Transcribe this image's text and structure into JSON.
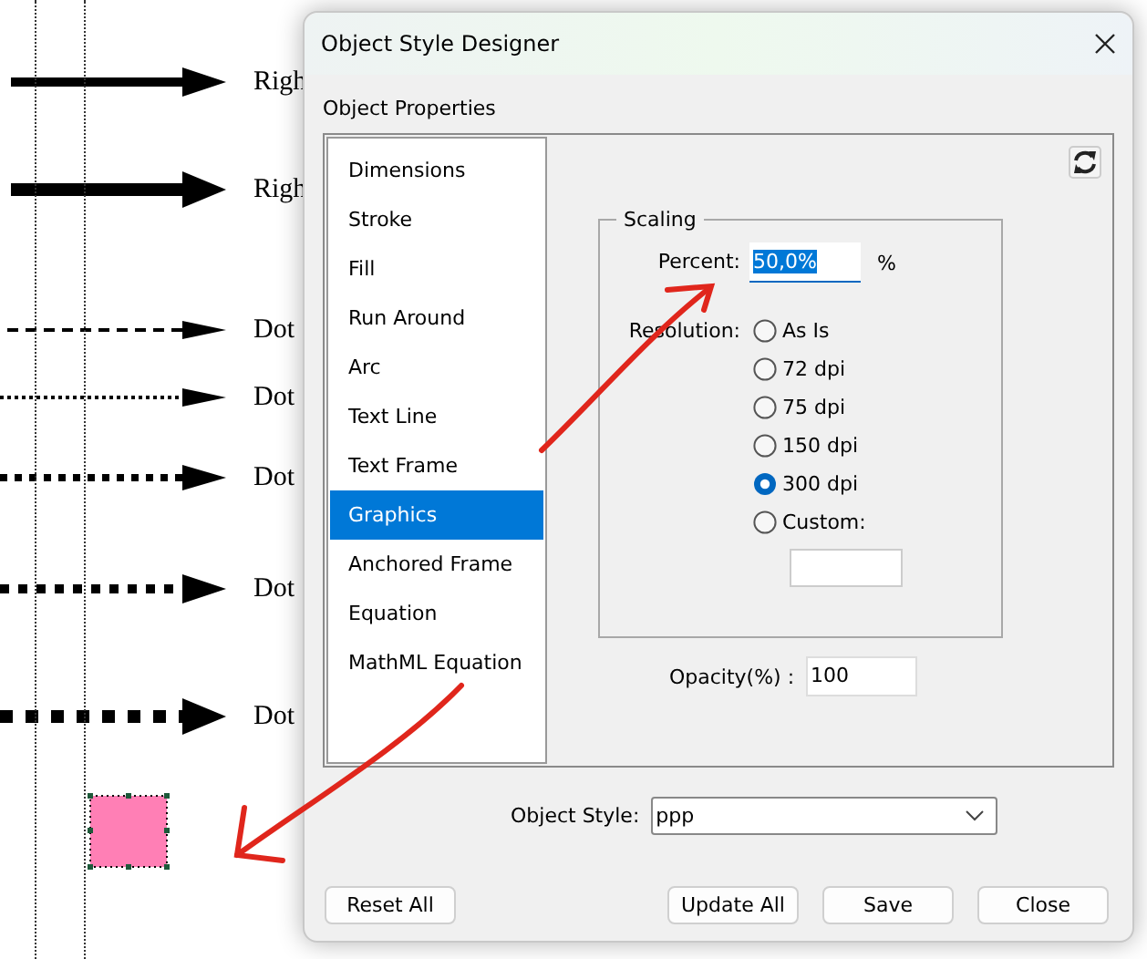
{
  "document": {
    "rows": [
      {
        "kind": "solid",
        "text": "Righ"
      },
      {
        "kind": "solid",
        "text": "Righ"
      },
      {
        "kind": "dashed",
        "text": "Dot"
      },
      {
        "kind": "dotted",
        "text": "Dot"
      },
      {
        "kind": "dotted",
        "text": "Dot"
      },
      {
        "kind": "dotted",
        "text": "Dot"
      },
      {
        "kind": "dotted",
        "text": "Dot"
      }
    ]
  },
  "dialog": {
    "title": "Object Style Designer",
    "section": "Object Properties",
    "categories": [
      {
        "label": "Dimensions",
        "selected": false
      },
      {
        "label": "Stroke",
        "selected": false
      },
      {
        "label": "Fill",
        "selected": false
      },
      {
        "label": "Run Around",
        "selected": false
      },
      {
        "label": "Arc",
        "selected": false
      },
      {
        "label": "Text Line",
        "selected": false
      },
      {
        "label": "Text Frame",
        "selected": false
      },
      {
        "label": "Graphics",
        "selected": true
      },
      {
        "label": "Anchored Frame",
        "selected": false
      },
      {
        "label": "Equation",
        "selected": false
      },
      {
        "label": "MathML Equation",
        "selected": false
      }
    ],
    "scaling": {
      "title": "Scaling",
      "percent_label": "Percent:",
      "percent_value": "50,0%",
      "percent_value_selected": true,
      "percent_unit": "%",
      "resolution_label": "Resolution:",
      "resolutions": [
        {
          "label": "As Is",
          "selected": false
        },
        {
          "label": "72 dpi",
          "selected": false
        },
        {
          "label": "75 dpi",
          "selected": false
        },
        {
          "label": "150 dpi",
          "selected": false
        },
        {
          "label": "300 dpi",
          "selected": true
        },
        {
          "label": "Custom:",
          "selected": false
        }
      ]
    },
    "opacity_label": "Opacity(%) :",
    "opacity_value": "100",
    "object_style_label": "Object Style:",
    "object_style_value": "ppp",
    "buttons": [
      "Reset All",
      "Update All",
      "Save",
      "Close"
    ]
  }
}
